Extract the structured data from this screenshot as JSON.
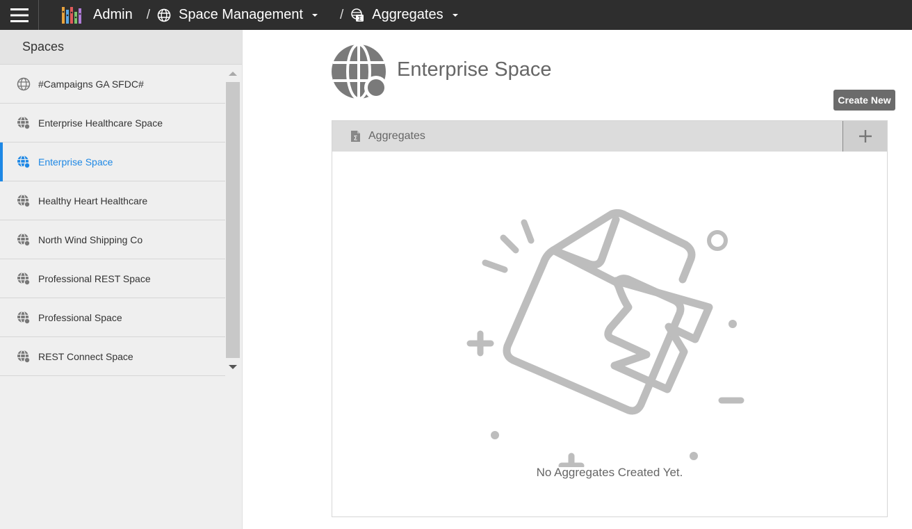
{
  "topbar": {
    "menu_icon": "hamburger-icon",
    "logo_icon": "app-logo",
    "admin_label": "Admin",
    "separator": "/",
    "breadcrumbs": [
      {
        "label": "Space Management",
        "icon": "globe-icon"
      },
      {
        "label": "Aggregates",
        "icon": "aggregates-icon"
      }
    ]
  },
  "sidebar": {
    "title": "Spaces",
    "items": [
      {
        "label": "#Campaigns GA SFDC#",
        "icon": "globe-icon"
      },
      {
        "label": "Enterprise Healthcare Space",
        "icon": "globe-dot-icon"
      },
      {
        "label": "Enterprise Space",
        "icon": "globe-dot-icon"
      },
      {
        "label": "Healthy Heart Healthcare",
        "icon": "globe-dot-icon"
      },
      {
        "label": "North Wind Shipping Co",
        "icon": "globe-dot-icon"
      },
      {
        "label": "Professional REST Space",
        "icon": "globe-dot-icon"
      },
      {
        "label": "Professional Space",
        "icon": "globe-dot-icon"
      },
      {
        "label": "REST Connect Space",
        "icon": "globe-dot-icon"
      }
    ],
    "active_index": 2
  },
  "main": {
    "title": "Enterprise Space",
    "create_label": "Create New",
    "panel": {
      "title": "Aggregates",
      "add_icon": "plus-icon",
      "empty_text": "No Aggregates Created Yet."
    }
  },
  "colors": {
    "topbar": "#2e2e2e",
    "accent": "#1e88e5",
    "sidebar_bg": "#efefef",
    "button": "#6b6b6b",
    "illustration": "#bdbdbd"
  }
}
